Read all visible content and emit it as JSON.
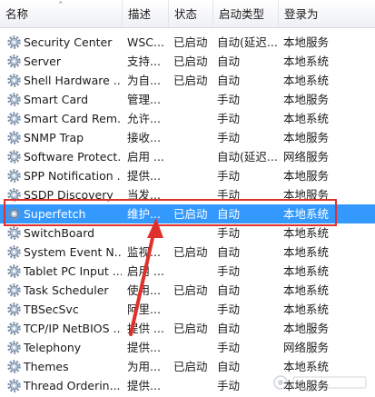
{
  "columns": {
    "name": "名称",
    "desc": "描述",
    "status": "状态",
    "start": "启动类型",
    "logon": "登录为"
  },
  "rows": [
    {
      "name": "Security Center",
      "desc": "WSC...",
      "status": "已启动",
      "start": "自动(延迟...",
      "logon": "本地服务"
    },
    {
      "name": "Server",
      "desc": "支持...",
      "status": "已启动",
      "start": "自动",
      "logon": "本地系统"
    },
    {
      "name": "Shell Hardware ...",
      "desc": "为自...",
      "status": "已启动",
      "start": "自动",
      "logon": "本地系统"
    },
    {
      "name": "Smart Card",
      "desc": "管理...",
      "status": "",
      "start": "手动",
      "logon": "本地服务"
    },
    {
      "name": "Smart Card Rem...",
      "desc": "允许...",
      "status": "",
      "start": "手动",
      "logon": "本地系统"
    },
    {
      "name": "SNMP Trap",
      "desc": "接收...",
      "status": "",
      "start": "手动",
      "logon": "本地服务"
    },
    {
      "name": "Software Protect...",
      "desc": "启用 ...",
      "status": "",
      "start": "自动(延迟...",
      "logon": "网络服务"
    },
    {
      "name": "SPP Notification ...",
      "desc": "提供...",
      "status": "",
      "start": "手动",
      "logon": "本地服务"
    },
    {
      "name": "SSDP Discovery",
      "desc": "当发...",
      "status": "",
      "start": "手动",
      "logon": "本地服务"
    },
    {
      "name": "Superfetch",
      "desc": "维护...",
      "status": "已启动",
      "start": "自动",
      "logon": "本地系统"
    },
    {
      "name": "SwitchBoard",
      "desc": "",
      "status": "",
      "start": "手动",
      "logon": "本地系统"
    },
    {
      "name": "System Event N...",
      "desc": "监视...",
      "status": "已启动",
      "start": "自动",
      "logon": "本地系统"
    },
    {
      "name": "Tablet PC Input ...",
      "desc": "启用 ...",
      "status": "",
      "start": "手动",
      "logon": "本地系统"
    },
    {
      "name": "Task Scheduler",
      "desc": "使用...",
      "status": "已启动",
      "start": "自动",
      "logon": "本地系统"
    },
    {
      "name": "TBSecSvc",
      "desc": "阿里...",
      "status": "",
      "start": "手动",
      "logon": "本地系统"
    },
    {
      "name": "TCP/IP NetBIOS ...",
      "desc": "提供 ...",
      "status": "已启动",
      "start": "自动",
      "logon": "本地服务"
    },
    {
      "name": "Telephony",
      "desc": "提供...",
      "status": "",
      "start": "手动",
      "logon": "网络服务"
    },
    {
      "name": "Themes",
      "desc": "为用...",
      "status": "已启动",
      "start": "自动",
      "logon": "本地系统"
    },
    {
      "name": "Thread Orderin...",
      "desc": "提供...",
      "status": "",
      "start": "手动",
      "logon": "本地服务"
    }
  ],
  "selected_index": 9,
  "icons": {
    "service": "gear-icon",
    "sort": "sort-ascending-icon"
  },
  "colors": {
    "selection": "#3399ff",
    "highlight_box": "#e0302c",
    "annotation_arrow": "#e0302c"
  }
}
